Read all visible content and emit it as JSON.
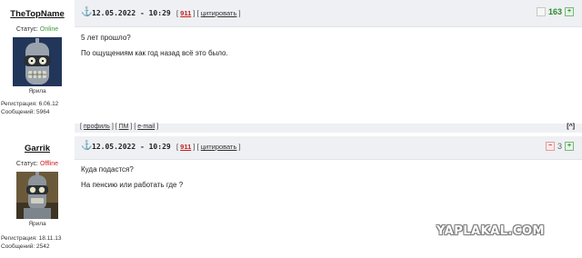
{
  "posts": [
    {
      "nick": "TheTopName",
      "status_label": "Статус: ",
      "status_value": "Online",
      "rank": "Ярила",
      "registered": "Регистрация: 6.06.12",
      "messages": "Сообщений: 5964",
      "anchor": "⚓",
      "date": "12.05.2022 - 10:29",
      "post_number": "911",
      "cite": "цитировать",
      "rating_up": "+",
      "rating": "163",
      "lines": [
        "5 лет прошло?",
        "По ощущениям как год назад всё это было."
      ],
      "footer": {
        "profile": "профиль",
        "pm": "ПМ",
        "email": "e-mail",
        "up": "^"
      }
    },
    {
      "nick": "Garrik",
      "status_label": "Статус: ",
      "status_value": "Offline",
      "rank": "Ярила",
      "registered": "Регистрация: 18.11.13",
      "messages": "Сообщений: 2542",
      "anchor": "⚓",
      "date": "12.05.2022 - 10:29",
      "post_number": "911",
      "cite": "цитировать",
      "rating_down": "−",
      "rating": "3",
      "rating_up": "+",
      "lines": [
        "Куда подастся?",
        "На пенсию или работать где ?"
      ]
    }
  ],
  "watermark": "YAPLAKAL.COM"
}
